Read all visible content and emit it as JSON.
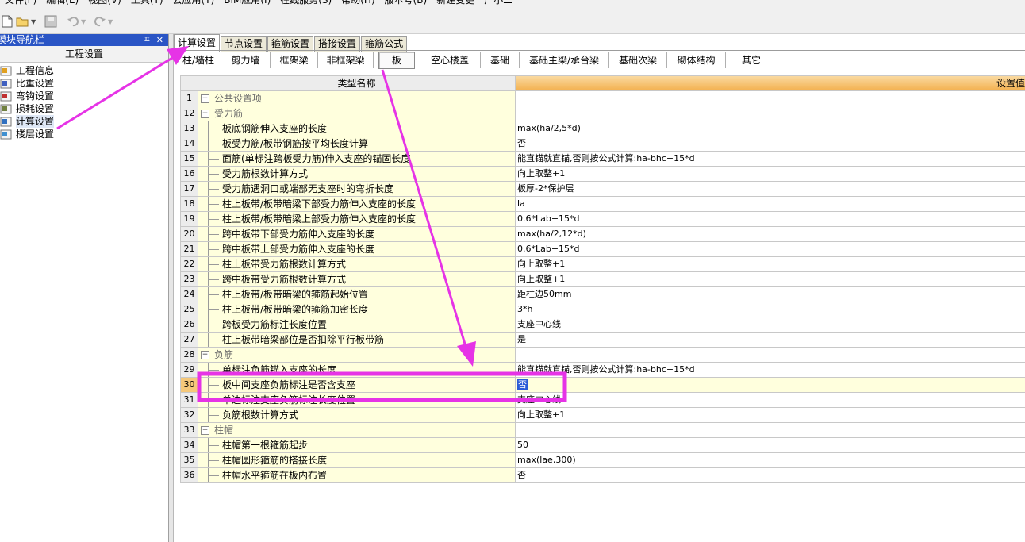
{
  "menu": [
    "文件(F)",
    "编辑(E)",
    "视图(V)",
    "工具(T)",
    "云应用(Y)",
    "BIM应用(I)",
    "在线服务(S)",
    "帮助(H)",
    "版本号(B)",
    "新建变更",
    "广小二"
  ],
  "nav": {
    "title": "模块导航栏",
    "pin": "ㅍ",
    "close": "✕",
    "header": "工程设置",
    "items": [
      {
        "label": "工程信息"
      },
      {
        "label": "比重设置"
      },
      {
        "label": "弯钩设置"
      },
      {
        "label": "损耗设置"
      },
      {
        "label": "计算设置"
      },
      {
        "label": "楼层设置"
      }
    ]
  },
  "tabs": [
    "计算设置",
    "节点设置",
    "箍筋设置",
    "搭接设置",
    "箍筋公式"
  ],
  "subtabs": [
    "柱/墙柱",
    "剪力墙",
    "框架梁",
    "非框架梁",
    "板",
    "空心楼盖",
    "基础",
    "基础主梁/承台梁",
    "基础次梁",
    "砌体结构",
    "其它"
  ],
  "grid": {
    "header": {
      "name": "类型名称",
      "value": "设置值"
    },
    "rows": [
      {
        "num": "1",
        "name": "公共设置项",
        "value": "",
        "kind": "group",
        "exp": "+"
      },
      {
        "num": "12",
        "name": "受力筋",
        "value": "",
        "kind": "group",
        "exp": "−"
      },
      {
        "num": "13",
        "name": "板底钢筋伸入支座的长度",
        "value": "max(ha/2,5*d)"
      },
      {
        "num": "14",
        "name": "板受力筋/板带钢筋按平均长度计算",
        "value": "否"
      },
      {
        "num": "15",
        "name": "面筋(单标注跨板受力筋)伸入支座的锚固长度",
        "value": "能直锚就直锚,否则按公式计算:ha-bhc+15*d"
      },
      {
        "num": "16",
        "name": "受力筋根数计算方式",
        "value": "向上取整+1"
      },
      {
        "num": "17",
        "name": "受力筋遇洞口或端部无支座时的弯折长度",
        "value": "板厚-2*保护层"
      },
      {
        "num": "18",
        "name": "柱上板带/板带暗梁下部受力筋伸入支座的长度",
        "value": "la"
      },
      {
        "num": "19",
        "name": "柱上板带/板带暗梁上部受力筋伸入支座的长度",
        "value": "0.6*Lab+15*d"
      },
      {
        "num": "20",
        "name": "跨中板带下部受力筋伸入支座的长度",
        "value": "max(ha/2,12*d)"
      },
      {
        "num": "21",
        "name": "跨中板带上部受力筋伸入支座的长度",
        "value": "0.6*Lab+15*d"
      },
      {
        "num": "22",
        "name": "柱上板带受力筋根数计算方式",
        "value": "向上取整+1"
      },
      {
        "num": "23",
        "name": "跨中板带受力筋根数计算方式",
        "value": "向上取整+1"
      },
      {
        "num": "24",
        "name": "柱上板带/板带暗梁的箍筋起始位置",
        "value": "距柱边50mm"
      },
      {
        "num": "25",
        "name": "柱上板带/板带暗梁的箍筋加密长度",
        "value": "3*h"
      },
      {
        "num": "26",
        "name": "跨板受力筋标注长度位置",
        "value": "支座中心线"
      },
      {
        "num": "27",
        "name": "柱上板带暗梁部位是否扣除平行板带筋",
        "value": "是"
      },
      {
        "num": "28",
        "name": "负筋",
        "value": "",
        "kind": "group",
        "exp": "−"
      },
      {
        "num": "29",
        "name": "单标注负筋锚入支座的长度",
        "value": "能直锚就直锚,否则按公式计算:ha-bhc+15*d"
      },
      {
        "num": "30",
        "name": "板中间支座负筋标注是否含支座",
        "value": "否",
        "selected": true
      },
      {
        "num": "31",
        "name": "单边标注支座负筋标注长度位置",
        "value": "支座中心线"
      },
      {
        "num": "32",
        "name": "负筋根数计算方式",
        "value": "向上取整+1"
      },
      {
        "num": "33",
        "name": "柱帽",
        "value": "",
        "kind": "group",
        "exp": "−"
      },
      {
        "num": "34",
        "name": "柱帽第一根箍筋起步",
        "value": "50"
      },
      {
        "num": "35",
        "name": "柱帽圆形箍筋的搭接长度",
        "value": "max(lae,300)"
      },
      {
        "num": "36",
        "name": "柱帽水平箍筋在板内布置",
        "value": "否"
      }
    ]
  },
  "colors": {
    "annotation": "#e633e6",
    "selection": "#2a5bd7",
    "nav_title": "#2a55c5",
    "header_orange": "#f3b150"
  }
}
